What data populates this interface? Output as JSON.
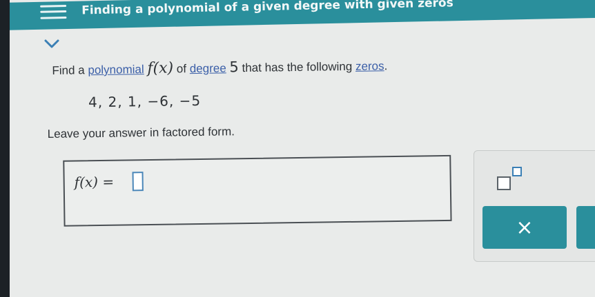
{
  "header": {
    "title": "Finding a polynomial of a given degree with given zeros"
  },
  "question": {
    "find_a": "Find a",
    "polynomial_link": "polynomial",
    "function_notation": "f(x)",
    "of": "of",
    "degree_link": "degree",
    "degree_value": "5",
    "middle": "that has the following",
    "zeros_link": "zeros",
    "period": ".",
    "zeros_list": "4, 2, 1, −6, −5",
    "instruction": "Leave your answer in factored form."
  },
  "answer": {
    "label": "f(x) =",
    "value": ""
  },
  "toolbar": {
    "clear_label": "×"
  },
  "colors": {
    "accent": "#2a8f9c",
    "link": "#3b5fa8",
    "input_border": "#4a86b8"
  },
  "icons": {
    "menu": "hamburger-menu-icon",
    "collapse": "chevron-down-icon",
    "exponent": "exponent-template-icon",
    "clear": "close-icon"
  }
}
